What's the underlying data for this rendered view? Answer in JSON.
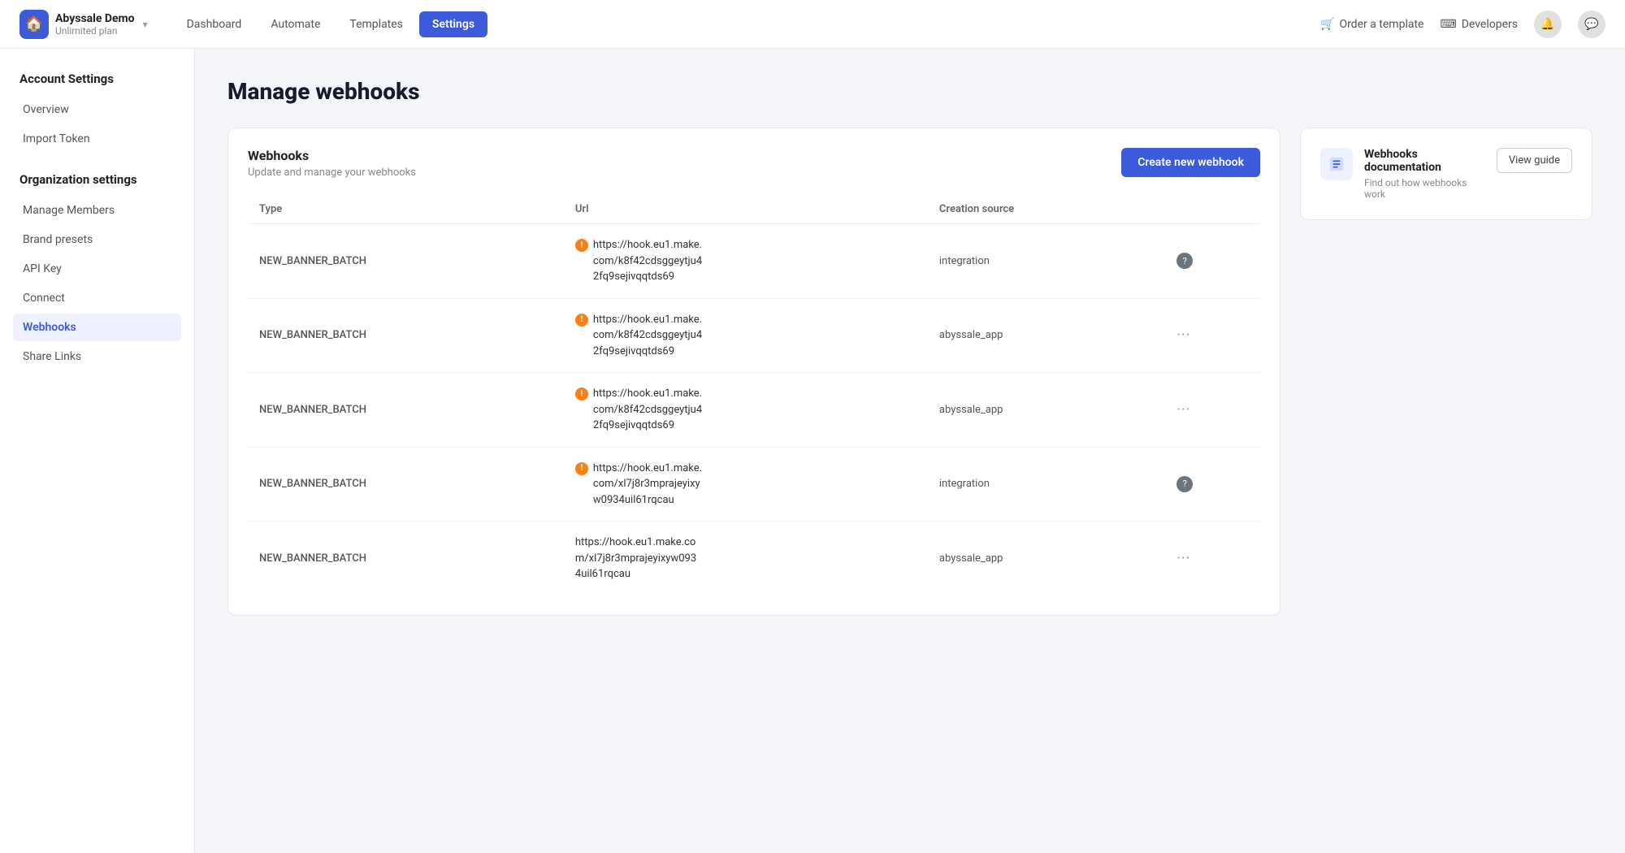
{
  "topbar": {
    "brand_name": "Abyssale Demo",
    "brand_plan": "Unlimited plan",
    "nav": [
      {
        "id": "dashboard",
        "label": "Dashboard",
        "active": false
      },
      {
        "id": "automate",
        "label": "Automate",
        "active": false
      },
      {
        "id": "templates",
        "label": "Templates",
        "active": false
      },
      {
        "id": "settings",
        "label": "Settings",
        "active": true
      }
    ],
    "order_label": "Order a template",
    "developers_label": "Developers"
  },
  "sidebar": {
    "account_title": "Account Settings",
    "account_items": [
      {
        "id": "overview",
        "label": "Overview",
        "active": false
      },
      {
        "id": "import-token",
        "label": "Import Token",
        "active": false
      }
    ],
    "org_title": "Organization settings",
    "org_items": [
      {
        "id": "manage-members",
        "label": "Manage Members",
        "active": false
      },
      {
        "id": "brand-presets",
        "label": "Brand presets",
        "active": false
      },
      {
        "id": "api-key",
        "label": "API Key",
        "active": false
      },
      {
        "id": "connect",
        "label": "Connect",
        "active": false
      },
      {
        "id": "webhooks",
        "label": "Webhooks",
        "active": true
      },
      {
        "id": "share-links",
        "label": "Share Links",
        "active": false
      }
    ]
  },
  "main": {
    "page_title": "Manage webhooks",
    "webhooks_card": {
      "title": "Webhooks",
      "subtitle": "Update and manage your webhooks",
      "create_btn": "Create new webhook",
      "columns": [
        "Type",
        "Url",
        "Creation source"
      ],
      "rows": [
        {
          "type": "NEW_BANNER_BATCH",
          "url": "https://hook.eu1.make.\ncom/k8f42cdsggeytju4\n2fq9sejivqqtds69",
          "source": "integration",
          "has_warn": true,
          "has_help": true,
          "has_more": false
        },
        {
          "type": "NEW_BANNER_BATCH",
          "url": "https://hook.eu1.make.\ncom/k8f42cdsggeytju4\n2fq9sejivqqtds69",
          "source": "abyssale_app",
          "has_warn": true,
          "has_help": false,
          "has_more": true
        },
        {
          "type": "NEW_BANNER_BATCH",
          "url": "https://hook.eu1.make.\ncom/k8f42cdsggeytju4\n2fq9sejivqqtds69",
          "source": "abyssale_app",
          "has_warn": true,
          "has_help": false,
          "has_more": true
        },
        {
          "type": "NEW_BANNER_BATCH",
          "url": "https://hook.eu1.make.\ncom/xl7j8r3mprajeyixy\nw0934uil61rqcau",
          "source": "integration",
          "has_warn": true,
          "has_help": true,
          "has_more": false
        },
        {
          "type": "NEW_BANNER_BATCH",
          "url": "https://hook.eu1.make.co\nm/xl7j8r3mprajeyixyw093\n4uil61rqcau",
          "source": "abyssale_app",
          "has_warn": false,
          "has_help": false,
          "has_more": true
        }
      ]
    },
    "docs_card": {
      "title": "Webhooks documentation",
      "subtitle": "Find out how webhooks work",
      "btn_label": "View guide"
    }
  }
}
